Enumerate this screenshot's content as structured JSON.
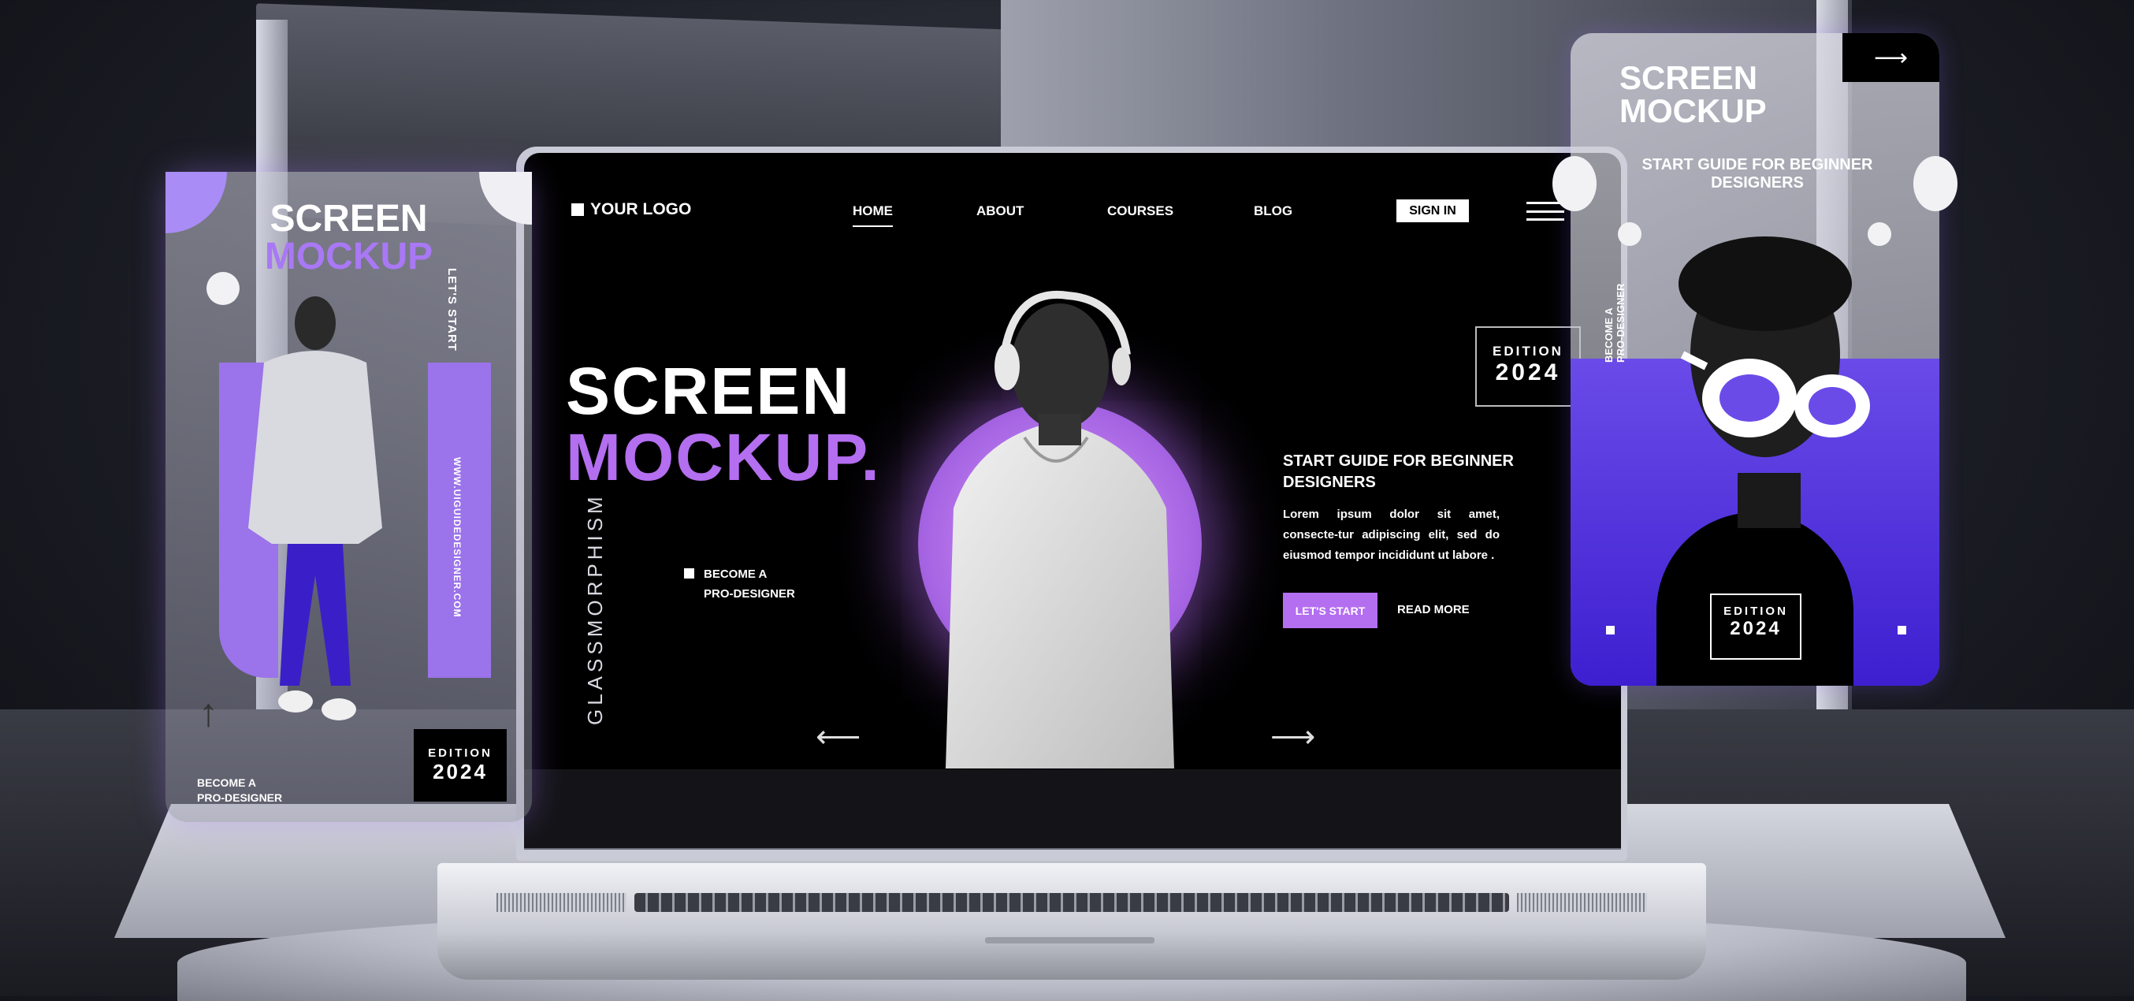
{
  "site": {
    "logo_text": "YOUR LOGO",
    "nav": [
      "HOME",
      "ABOUT",
      "COURSES",
      "BLOG"
    ],
    "sign_in": "SIGN IN",
    "hero_title_line1": "SCREEN",
    "hero_title_line2": "MOCKUP.",
    "vertical_label": "GLASSMORPHISM",
    "become_line1": "BECOME A",
    "become_line2": "PRO-DESIGNER",
    "edition_label": "EDITION",
    "edition_year": "2024",
    "guide_title": "START GUIDE FOR BEGINNER DESIGNERS",
    "lorem": "Lorem ipsum dolor sit amet, consecte-tur adipiscing elit, sed do eiusmod tempor incididunt ut labore .",
    "cta_primary": "LET'S START",
    "cta_secondary": "READ MORE",
    "arrow_left": "⟵",
    "arrow_right": "⟶"
  },
  "left_card": {
    "title_line1": "SCREEN",
    "title_line2": "MOCKUP",
    "side_text": "LET'S START",
    "url": "WWW.UIGUIDEDESIGNER.COM",
    "become_line1": "BECOME A",
    "become_line2": "PRO-DESIGNER",
    "edition_label": "EDITION",
    "edition_year": "2024",
    "arrow_up": "↑"
  },
  "right_card": {
    "title_line1": "SCREEN",
    "title_line2": "MOCKUP",
    "subtitle": "START GUIDE FOR BEGINNER DESIGNERS",
    "vertical_text_1": "BECOME A",
    "vertical_text_2": "PRO-DESIGNER",
    "edition_label": "EDITION",
    "edition_year": "2024",
    "arrow": "⟶"
  },
  "colors": {
    "accent_purple": "#b46ef0",
    "deep_purple": "#4a2bd8",
    "background": "#000000"
  }
}
